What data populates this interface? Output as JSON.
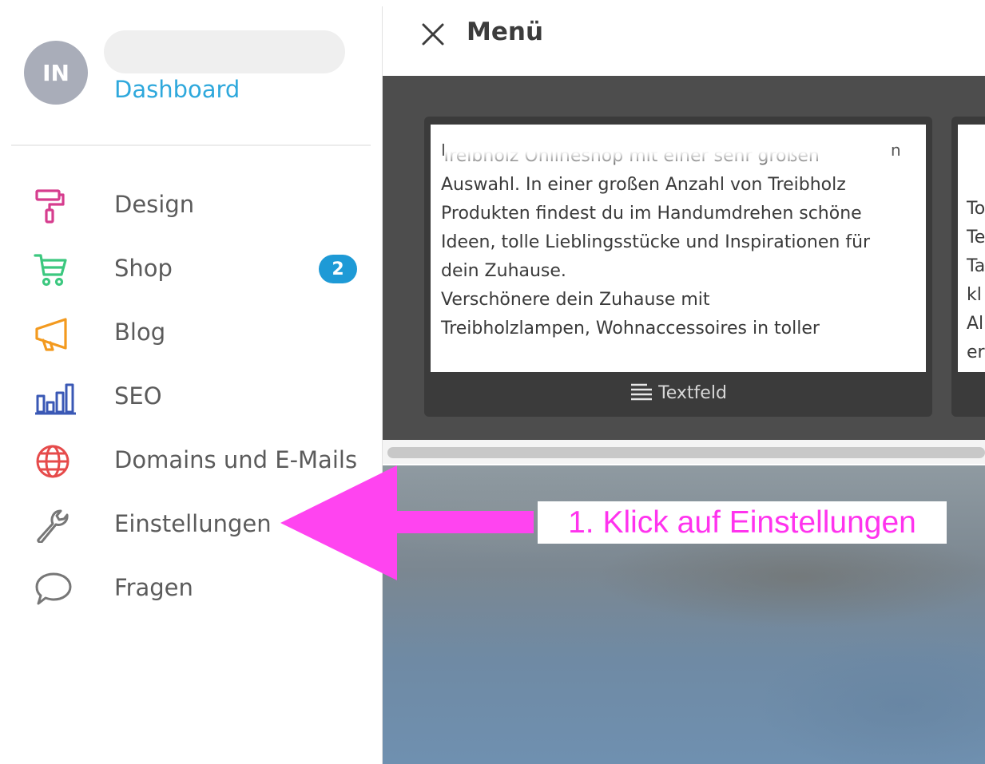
{
  "sidebar": {
    "avatar_initials": "IN",
    "dashboard_label": "Dashboard",
    "items": [
      {
        "label": "Design",
        "icon": "paint-roller-icon",
        "color": "#d63d8e"
      },
      {
        "label": "Shop",
        "icon": "shopping-cart-icon",
        "color": "#3cc87f",
        "badge": "2"
      },
      {
        "label": "Blog",
        "icon": "megaphone-icon",
        "color": "#f39a1f"
      },
      {
        "label": "SEO",
        "icon": "bar-chart-icon",
        "color": "#3a58b5"
      },
      {
        "label": "Domains und E-Mails",
        "icon": "globe-icon",
        "color": "#e64b4b"
      },
      {
        "label": "Einstellungen",
        "icon": "wrench-icon",
        "color": "#777777"
      },
      {
        "label": "Fragen",
        "icon": "speech-bubble-icon",
        "color": "#777777"
      }
    ],
    "badge_color": "#1e9ad6",
    "accent_color": "#2ea8dc"
  },
  "main": {
    "menu_title": "Menü",
    "card1": {
      "top_left_fragment": "I",
      "top_right_fragment": "n",
      "text": "Treibholz Onlineshop mit einer sehr großen\nAuswahl. In einer großen Anzahl von Treibholz\nProdukten findest du im Handumdrehen schöne\nIdeen, tolle Lieblingsstücke und Inspirationen für\ndein Zuhause.\nVerschönere dein Zuhause mit\nTreibholzlampen, Wohnaccessoires in toller",
      "footer_label": "Textfeld"
    },
    "card2": {
      "text": "To\nTe\nTa\nkl\nAl\ner"
    }
  },
  "annotation": {
    "text": "1. Klick auf Einstellungen",
    "color": "#ff33ee"
  }
}
